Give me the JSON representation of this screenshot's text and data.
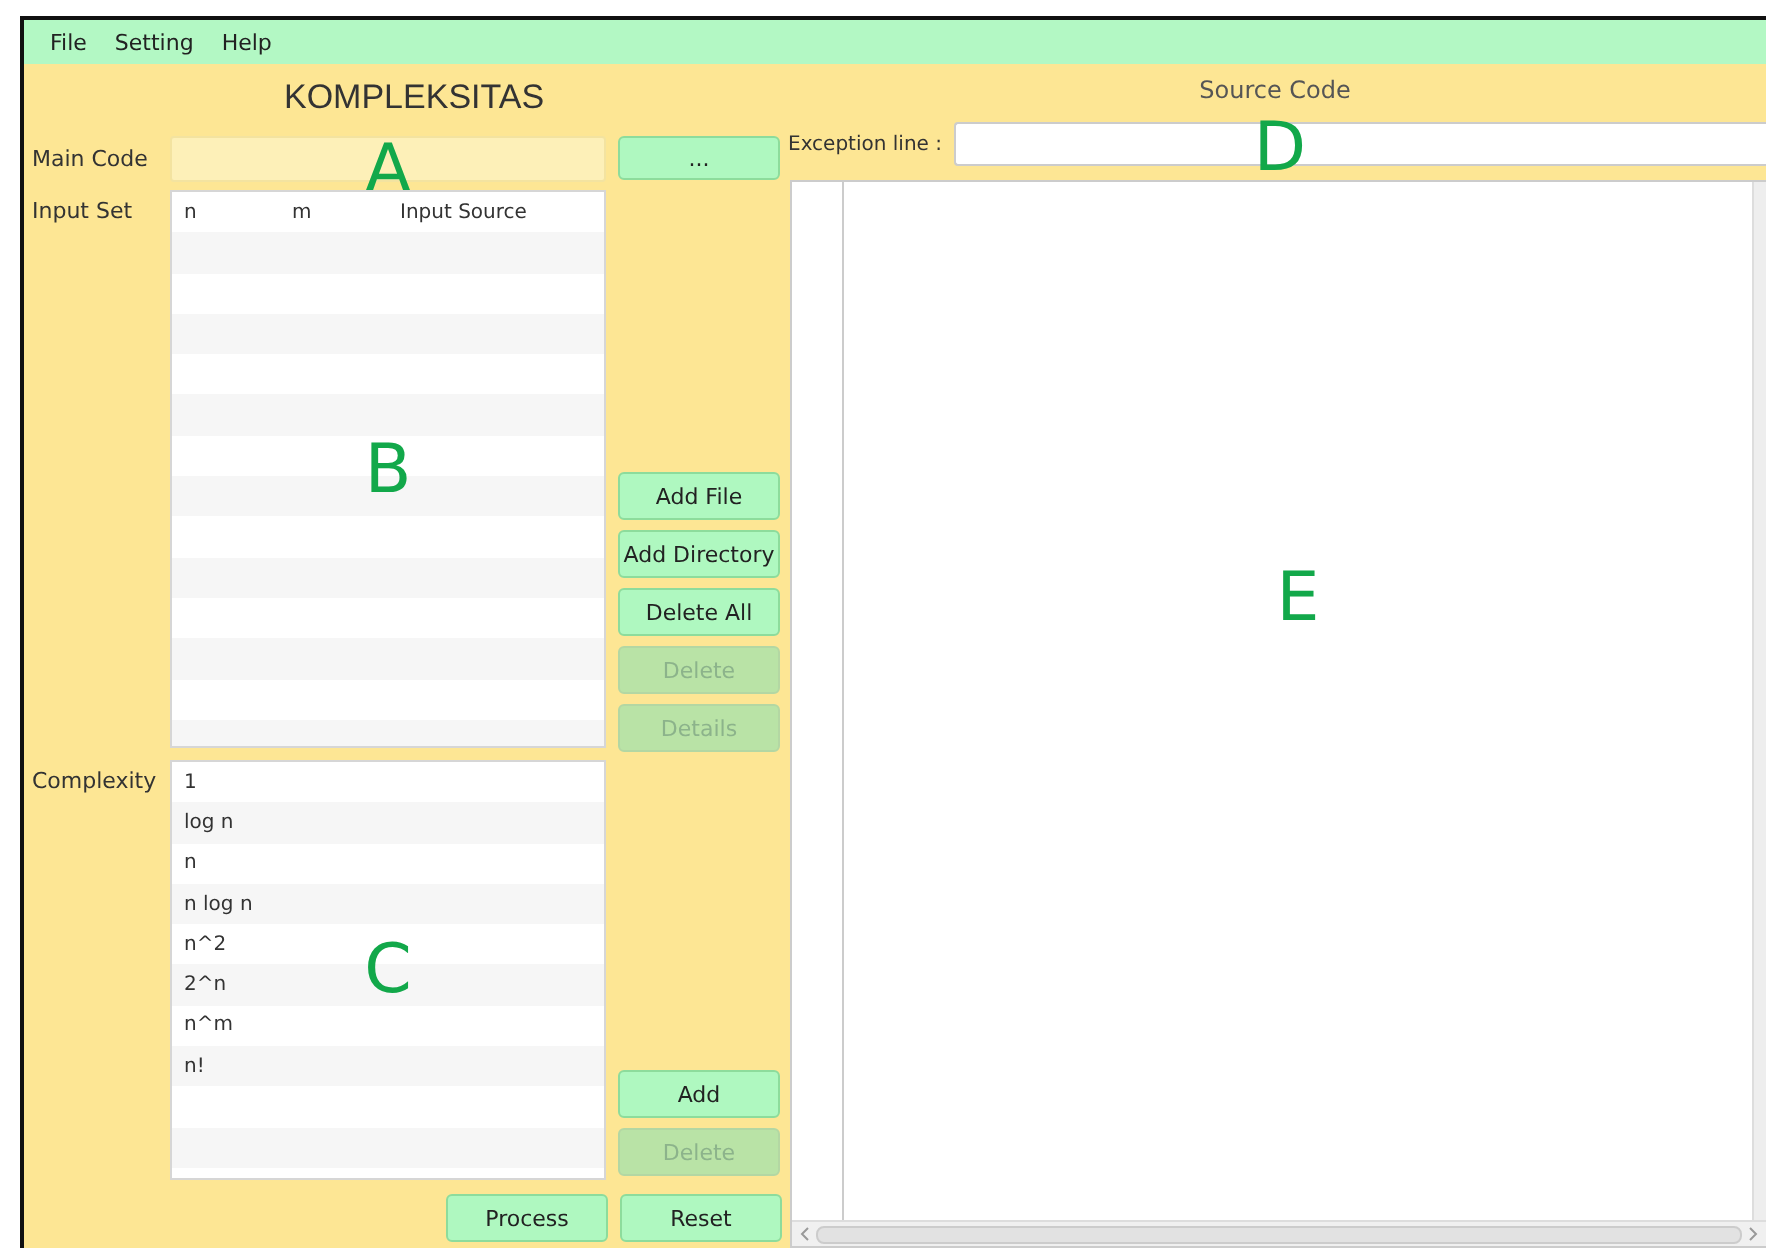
{
  "menu": [
    {
      "label": "File"
    },
    {
      "label": "Setting"
    },
    {
      "label": "Help"
    }
  ],
  "left": {
    "title": "KOMPLEKSITAS",
    "main_code": {
      "label": "Main Code",
      "browse_button": "...",
      "annotation": "A"
    },
    "input_set": {
      "label": "Input Set",
      "columns": [
        "n",
        "m",
        "Input Source"
      ],
      "annotation": "B",
      "buttons": [
        {
          "label": "Add File",
          "disabled": false
        },
        {
          "label": "Add Directory",
          "disabled": false
        },
        {
          "label": "Delete All",
          "disabled": false
        },
        {
          "label": "Delete",
          "disabled": true
        },
        {
          "label": "Details",
          "disabled": true
        }
      ]
    },
    "complexity": {
      "label": "Complexity",
      "annotation": "C",
      "items": [
        "1",
        "log n",
        "n",
        "n log n",
        "n^2",
        "2^n",
        "n^m",
        "n!"
      ],
      "buttons": [
        {
          "label": "Add",
          "disabled": false
        },
        {
          "label": "Delete",
          "disabled": true
        }
      ]
    },
    "bottom_buttons": [
      {
        "label": "Process",
        "disabled": false
      },
      {
        "label": "Reset",
        "disabled": false
      }
    ]
  },
  "right": {
    "title": "Source Code",
    "exception": {
      "label": "Exception line :",
      "annotation": "D"
    },
    "code_annotation": "E"
  }
}
